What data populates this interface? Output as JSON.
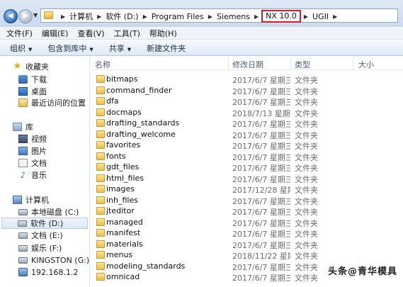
{
  "address": {
    "crumbs": [
      "计算机",
      "软件 (D:)",
      "Program Files",
      "Siemens",
      "NX 10.0",
      "UGII"
    ],
    "highlighted_crumb": "NX 10.0"
  },
  "menu": [
    "文件(F)",
    "编辑(E)",
    "查看(V)",
    "工具(T)",
    "帮助(H)"
  ],
  "toolbar": {
    "organize": "组织",
    "include_in_library": "包含到库中",
    "share": "共享",
    "new_folder": "新建文件夹"
  },
  "nav": {
    "favorites": "收藏夹",
    "downloads": "下载",
    "desktop": "桌面",
    "recent": "最近访问的位置",
    "libraries": "库",
    "videos": "视频",
    "pictures": "图片",
    "documents": "文档",
    "music": "音乐",
    "computer": "计算机",
    "drive_c": "本地磁盘 (C:)",
    "drive_d": "软件 (D:)",
    "drive_e": "文档 (E:)",
    "drive_f": "娱乐 (F:)",
    "drive_g": "KINGSTON (G:)",
    "network": "192.168.1.2"
  },
  "columns": {
    "name": "名称",
    "date": "修改日期",
    "type": "类型",
    "size": "大小"
  },
  "files": [
    {
      "name": "bitmaps",
      "date": "2017/6/7 星期三 ...",
      "type": "文件夹"
    },
    {
      "name": "command_finder",
      "date": "2017/6/7 星期三 ...",
      "type": "文件夹"
    },
    {
      "name": "dfa",
      "date": "2017/6/7 星期三 ...",
      "type": "文件夹"
    },
    {
      "name": "docmaps",
      "date": "2018/7/13 星期...",
      "type": "文件夹"
    },
    {
      "name": "drafting_standards",
      "date": "2017/6/7 星期三 ...",
      "type": "文件夹"
    },
    {
      "name": "drafting_welcome",
      "date": "2017/6/7 星期三 ...",
      "type": "文件夹"
    },
    {
      "name": "favorites",
      "date": "2017/6/7 星期三 ...",
      "type": "文件夹"
    },
    {
      "name": "fonts",
      "date": "2017/6/7 星期三 ...",
      "type": "文件夹"
    },
    {
      "name": "gdt_files",
      "date": "2017/6/7 星期三 ...",
      "type": "文件夹"
    },
    {
      "name": "html_files",
      "date": "2017/6/7 星期三 ...",
      "type": "文件夹"
    },
    {
      "name": "images",
      "date": "2017/12/28 星期...",
      "type": "文件夹"
    },
    {
      "name": "inh_files",
      "date": "2017/6/7 星期三 ...",
      "type": "文件夹"
    },
    {
      "name": "jteditor",
      "date": "2017/6/7 星期三 ...",
      "type": "文件夹"
    },
    {
      "name": "managed",
      "date": "2017/6/7 星期三 ...",
      "type": "文件夹"
    },
    {
      "name": "manifest",
      "date": "2017/6/7 星期三 ...",
      "type": "文件夹"
    },
    {
      "name": "materials",
      "date": "2017/6/7 星期三 ...",
      "type": "文件夹"
    },
    {
      "name": "menus",
      "date": "2018/11/22 星期...",
      "type": "文件夹"
    },
    {
      "name": "modeling_standards",
      "date": "2017/6/7 星期三 ...",
      "type": "文件夹"
    },
    {
      "name": "omnicad",
      "date": "2017/6/7 星期三 ...",
      "type": "文件夹"
    }
  ],
  "watermark": "头条@青华模具"
}
